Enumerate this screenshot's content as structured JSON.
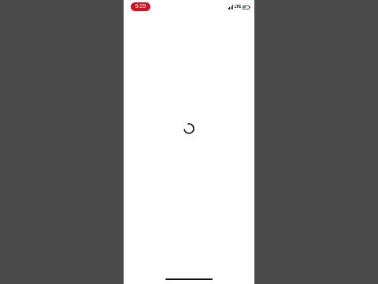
{
  "status_bar": {
    "time": "9:29",
    "time_pill_color": "#d0141f",
    "network": "LTE",
    "signal_icon": "cellular-signal-icon",
    "battery_icon": "battery-icon",
    "battery_level": 0.55,
    "battery_color": "#2ecc40"
  },
  "main": {
    "loading_icon": "loading-spinner-icon"
  }
}
